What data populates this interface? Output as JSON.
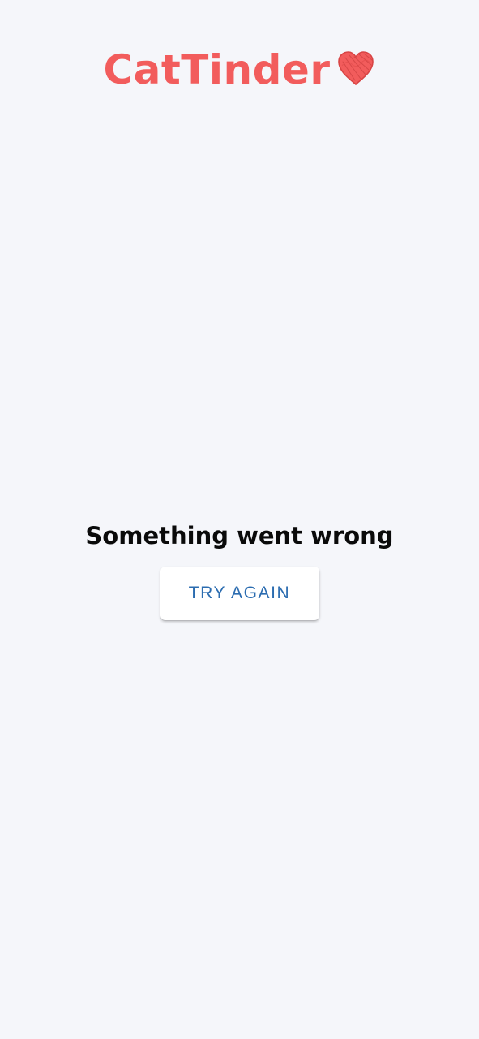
{
  "app": {
    "logo_text": "CatTinder",
    "logo_icon": "heart-icon",
    "brand_color": "#f25c5c"
  },
  "error": {
    "message": "Something went wrong",
    "retry_label": "TRY AGAIN",
    "retry_color": "#2b6cb0"
  },
  "colors": {
    "background": "#f5f6fa",
    "text": "#0a0a0a",
    "button_background": "#ffffff"
  }
}
